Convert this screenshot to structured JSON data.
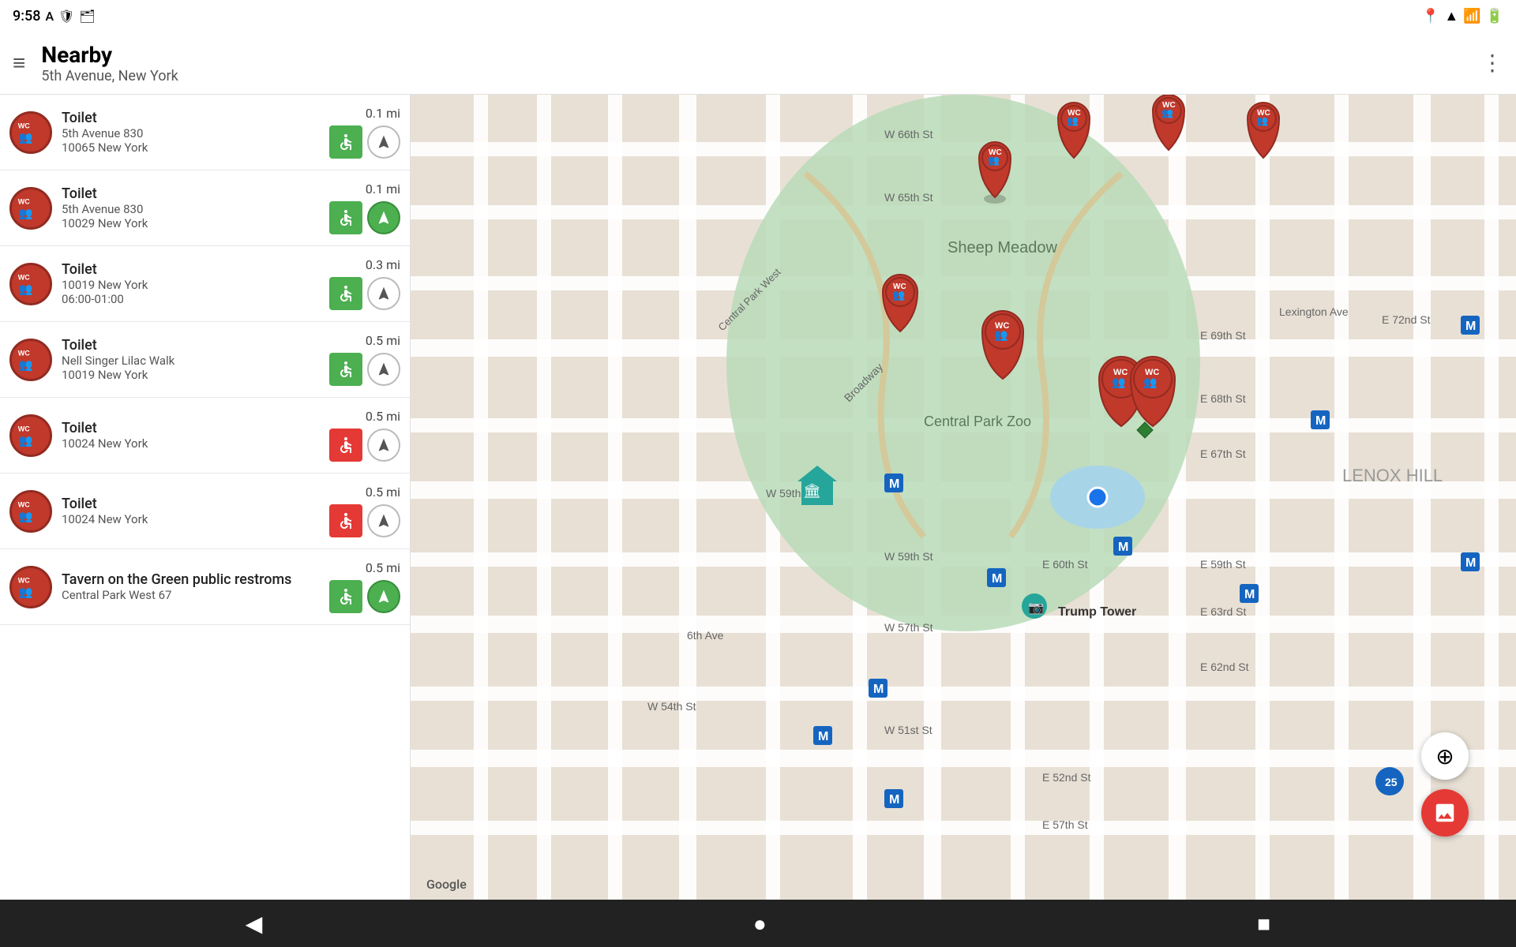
{
  "statusBar": {
    "time": "9:58",
    "icons": [
      "A",
      "shield",
      "battery-half"
    ]
  },
  "header": {
    "title": "Nearby",
    "subtitle": "5th Avenue, New York",
    "menuIcon": "≡",
    "moreIcon": "⋮"
  },
  "listItems": [
    {
      "name": "Toilet",
      "address": "5th Avenue 830",
      "city": "10065 New York",
      "distance": "0.1 mi",
      "hours": "",
      "accessible": "green",
      "hasNavFilled": false
    },
    {
      "name": "Toilet",
      "address": "5th Avenue 830",
      "city": "10029 New York",
      "distance": "0.1 mi",
      "hours": "",
      "accessible": "green",
      "hasNavFilled": true
    },
    {
      "name": "Toilet",
      "address": "10019 New York",
      "city": "06:00-01:00",
      "distance": "0.3 mi",
      "hours": "06:00-01:00",
      "accessible": "green",
      "hasNavFilled": false
    },
    {
      "name": "Toilet",
      "address": "Nell Singer Lilac Walk",
      "city": "10019 New York",
      "distance": "0.5 mi",
      "hours": "",
      "accessible": "green",
      "hasNavFilled": false
    },
    {
      "name": "Toilet",
      "address": "10024 New York",
      "city": "",
      "distance": "0.5 mi",
      "hours": "",
      "accessible": "red",
      "hasNavFilled": false
    },
    {
      "name": "Toilet",
      "address": "10024 New York",
      "city": "",
      "distance": "0.5 mi",
      "hours": "",
      "accessible": "red",
      "hasNavFilled": false
    },
    {
      "name": "Tavern on the Green public restroms",
      "address": "Central Park West 67",
      "city": "",
      "distance": "0.5 mi",
      "hours": "",
      "accessible": "green",
      "hasNavFilled": true
    }
  ],
  "map": {
    "googleLogo": "Google",
    "locationBtnLabel": "⊕",
    "photoBtnLabel": "🖼"
  },
  "bottomNav": {
    "backLabel": "◀",
    "homeLabel": "●",
    "recentLabel": "■"
  }
}
